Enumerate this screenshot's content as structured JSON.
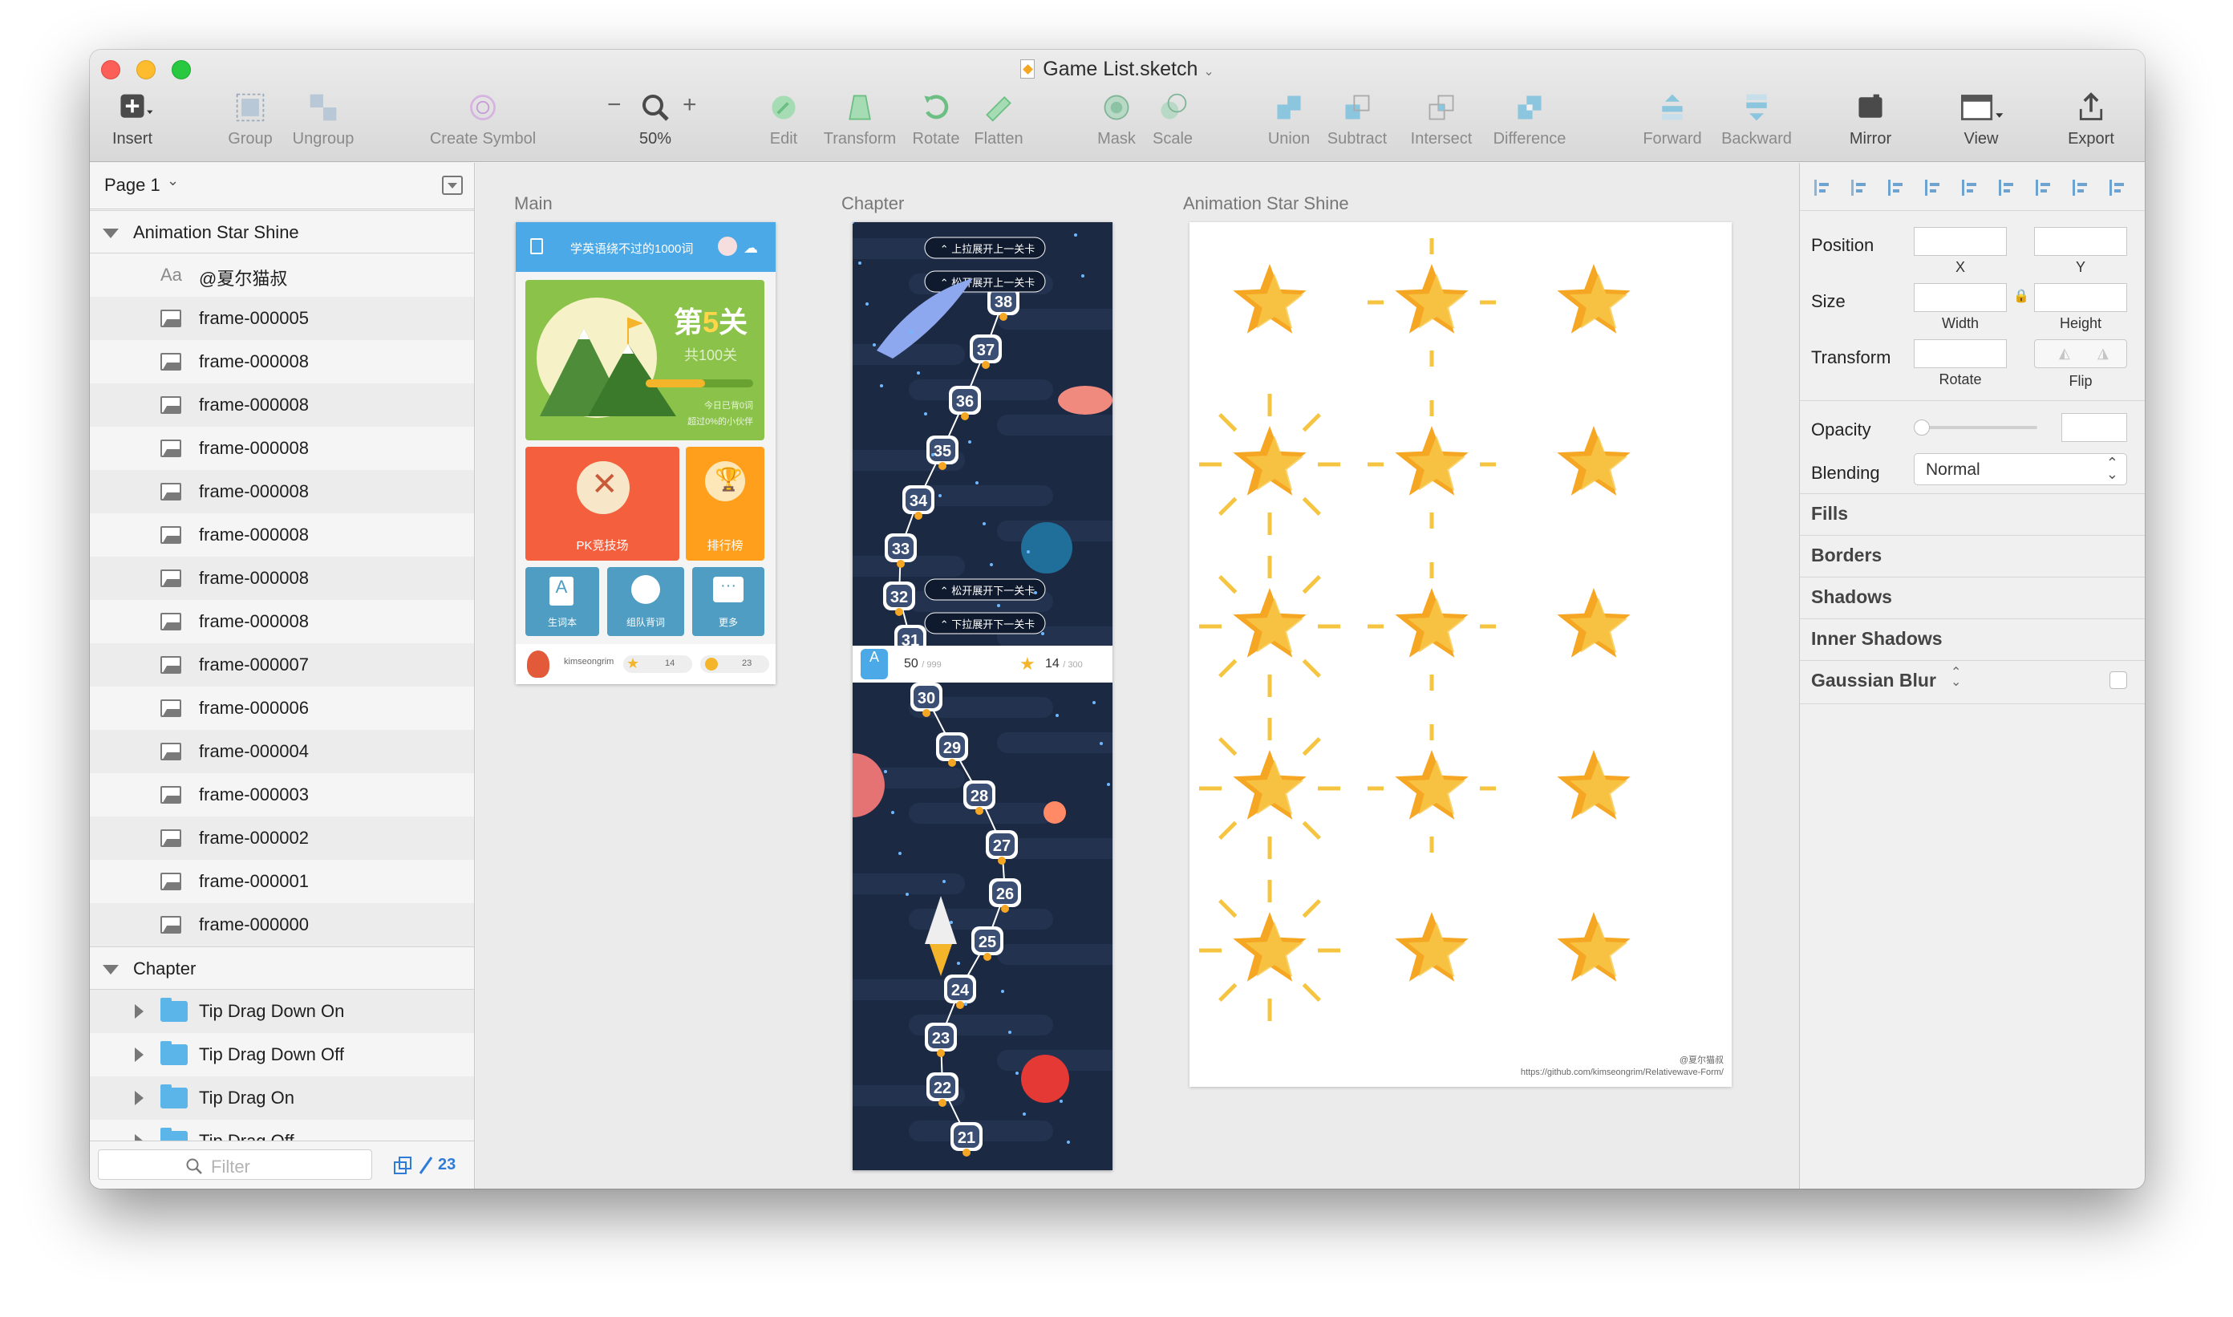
{
  "window": {
    "title": "Game List.sketch"
  },
  "toolbar": {
    "insert": "Insert",
    "group": "Group",
    "ungroup": "Ungroup",
    "create_symbol": "Create Symbol",
    "zoom": "50%",
    "edit": "Edit",
    "transform": "Transform",
    "rotate": "Rotate",
    "flatten": "Flatten",
    "mask": "Mask",
    "scale": "Scale",
    "union": "Union",
    "subtract": "Subtract",
    "intersect": "Intersect",
    "difference": "Difference",
    "forward": "Forward",
    "backward": "Backward",
    "mirror": "Mirror",
    "view": "View",
    "export": "Export"
  },
  "sidebar": {
    "page": "Page 1",
    "group1": {
      "name": "Animation Star Shine",
      "layers": [
        "Aa",
        "@夏尔猫叔",
        "frame-000005",
        "frame-000008",
        "frame-000008",
        "frame-000008",
        "frame-000008",
        "frame-000008",
        "frame-000008",
        "frame-000008",
        "frame-000007",
        "frame-000006",
        "frame-000004",
        "frame-000003",
        "frame-000002",
        "frame-000001",
        "frame-000000"
      ]
    },
    "group2": {
      "name": "Chapter",
      "layers": [
        "Tip Drag Down On",
        "Tip Drag Down Off",
        "Tip Drag On",
        "Tip Drag Off"
      ]
    },
    "filter_placeholder": "Filter",
    "count": "23"
  },
  "canvas": {
    "artboards": [
      "Main",
      "Chapter",
      "Animation Star Shine"
    ],
    "main": {
      "header": "学英语绕不过的1000词",
      "level_prefix": "第",
      "level_num": "5",
      "level_suffix": "关",
      "total": "共100关",
      "progress": 0.55,
      "stat1": "今日已背0词",
      "stat2": "超过0%的小伙伴",
      "pk": "PK竞技场",
      "rank": "排行榜",
      "tile1": "生词本",
      "tile2": "组队背词",
      "tile3": "更多",
      "user": "kimseongrim",
      "stars": "14",
      "coins": "23"
    },
    "chapter": {
      "tip_top1": "上拉展开上一关卡",
      "tip_top2": "松开展开上一关卡",
      "tip_bot1": "松开展开下一关卡",
      "tip_bot2": "下拉展开下一关卡",
      "nodes_top": [
        "38",
        "37",
        "36",
        "35",
        "34",
        "33",
        "32",
        "31"
      ],
      "nodes_bottom": [
        "30",
        "29",
        "28",
        "27",
        "26",
        "25",
        "24",
        "23",
        "22",
        "21"
      ],
      "score": "50",
      "score_total": "/ 999",
      "stars": "14",
      "stars_total": "/ 300"
    },
    "shine": {
      "credit1": "@夏尔猫叔",
      "credit2": "https://github.com/kimseongrim/Relativewave-Form/"
    }
  },
  "inspector": {
    "position": "Position",
    "x": "X",
    "y": "Y",
    "size": "Size",
    "width": "Width",
    "height": "Height",
    "transform": "Transform",
    "rotate": "Rotate",
    "flip": "Flip",
    "opacity": "Opacity",
    "blending": "Blending",
    "blending_value": "Normal",
    "fills": "Fills",
    "borders": "Borders",
    "shadows": "Shadows",
    "inner_shadows": "Inner Shadows",
    "gaussian_blur": "Gaussian Blur"
  },
  "colors": {
    "accent": "#2f7bd9",
    "star": "#f5b52a",
    "space": "#1b2942",
    "main_blue": "#4aa9e6",
    "green": "#8bc34a",
    "orange": "#ff9800"
  }
}
